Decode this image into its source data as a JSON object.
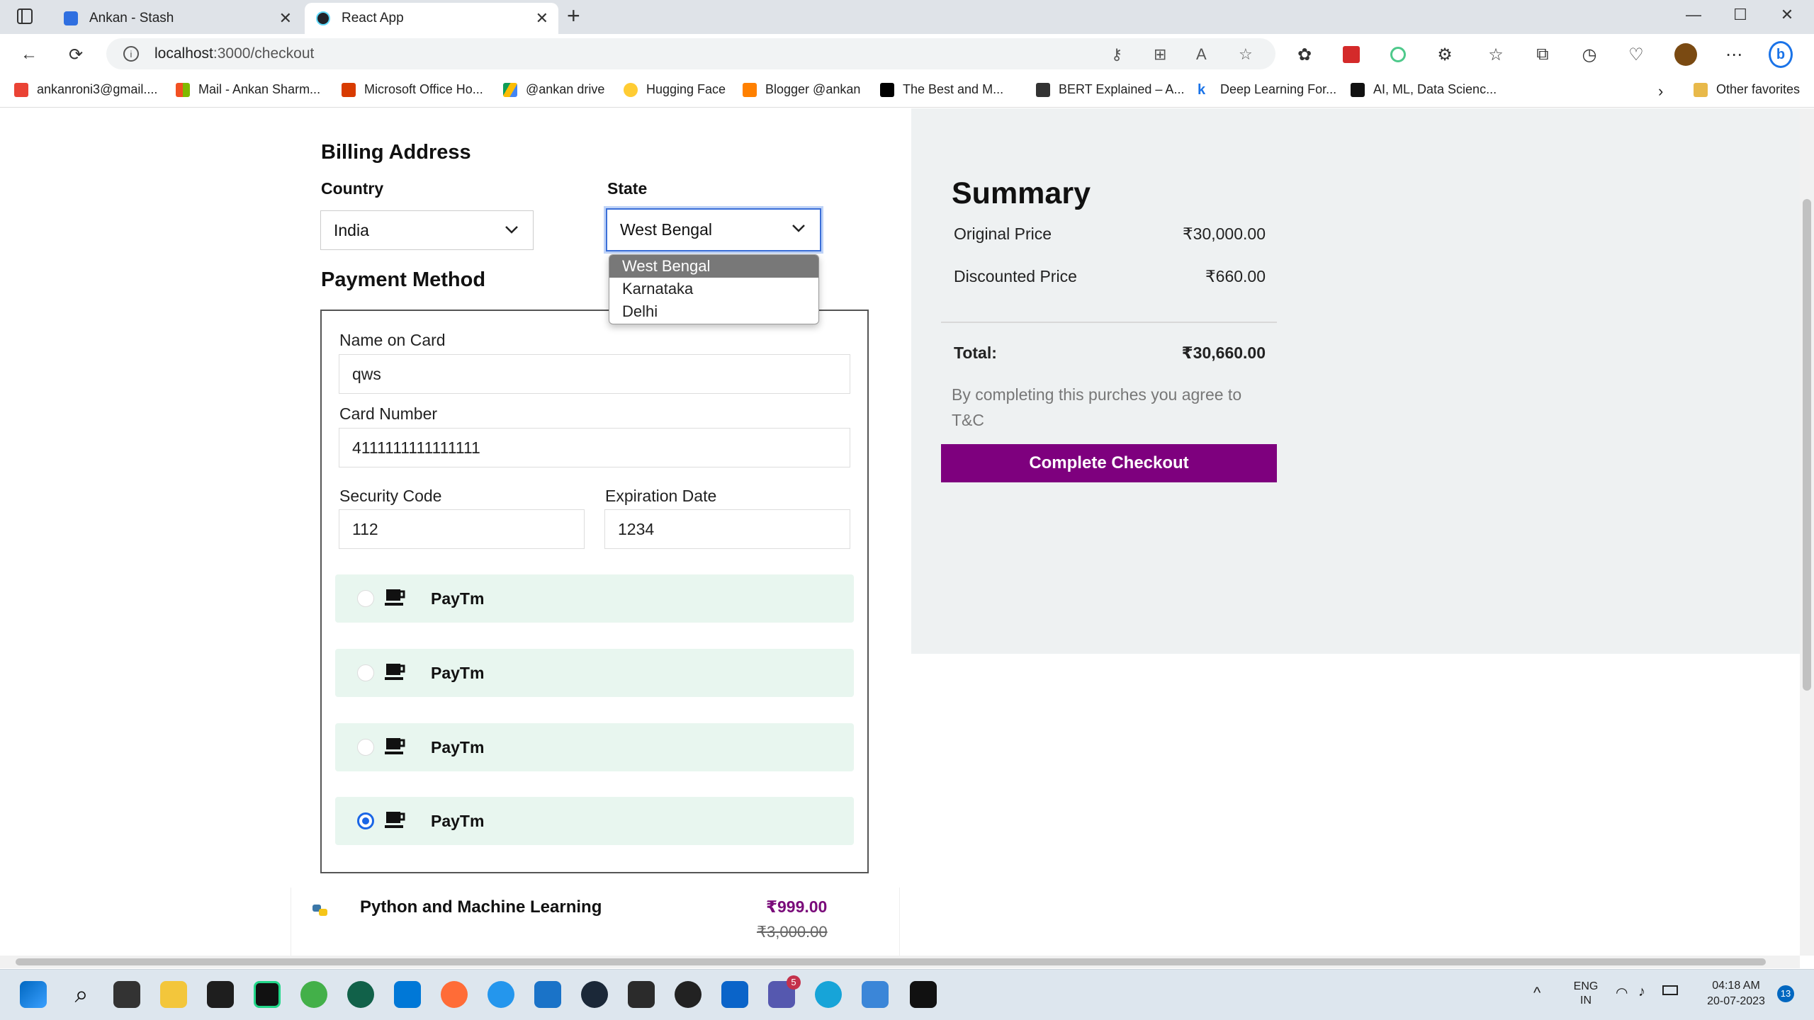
{
  "browser": {
    "tabs": [
      {
        "title": "Ankan - Stash"
      },
      {
        "title": "React App"
      }
    ],
    "url_host": "localhost",
    "url_path": ":3000/checkout",
    "bookmarks": [
      "ankanroni3@gmail....",
      "Mail - Ankan Sharm...",
      "Microsoft Office Ho...",
      "@ankan drive",
      "Hugging Face",
      "Blogger @ankan",
      "The Best and M...",
      "BERT Explained – A...",
      "Deep Learning For...",
      "AI, ML, Data Scienc..."
    ],
    "other_favorites": "Other favorites"
  },
  "billing": {
    "heading": "Billing Address",
    "country_label": "Country",
    "country_value": "India",
    "state_label": "State",
    "state_value": "West Bengal",
    "state_options": [
      "West Bengal",
      "Karnataka",
      "Delhi"
    ]
  },
  "payment": {
    "heading": "Payment Method",
    "name_label": "Name on Card",
    "name_value": "qws",
    "card_label": "Card Number",
    "card_value": "4111111111111111",
    "cvv_label": "Security Code",
    "cvv_value": "112",
    "exp_label": "Expiration Date",
    "exp_value": "1234",
    "options": [
      {
        "name": "PayTm",
        "selected": false
      },
      {
        "name": "PayTm",
        "selected": false
      },
      {
        "name": "PayTm",
        "selected": false
      },
      {
        "name": "PayTm",
        "selected": true
      }
    ]
  },
  "product": {
    "name": "Python and Machine Learning",
    "price": "₹999.00",
    "old_price": "₹3,000.00"
  },
  "summary": {
    "heading": "Summary",
    "original_label": "Original Price",
    "original_value": "₹30,000.00",
    "discount_label": "Discounted Price",
    "discount_value": "₹660.00",
    "total_label": "Total:",
    "total_value": "₹30,660.00",
    "tnc": "By completing this purches you agree to T&C",
    "checkout_label": "Complete Checkout"
  },
  "taskbar": {
    "lang_line1": "ENG",
    "lang_line2": "IN",
    "time": "04:18 AM",
    "date": "20-07-2023",
    "notification_count": "13",
    "teams_badge": "5"
  },
  "colors": {
    "accent": "#7e007e",
    "summary_bg": "#eef1f2",
    "payopt_bg": "#e8f6ef",
    "radio_blue": "#1a66e6"
  }
}
